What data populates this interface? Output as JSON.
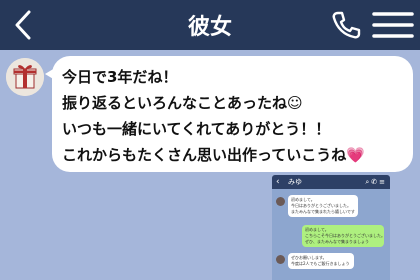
{
  "header": {
    "title": "彼女",
    "back_icon": "chevron-left-icon",
    "call_icon": "phone-icon",
    "menu_icon": "hamburger-menu-icon"
  },
  "colors": {
    "header_bg": "#263859",
    "chat_bg": "#a5b6da",
    "bubble_bg": "#ffffff"
  },
  "message": {
    "avatar_icon": "gift-box-icon",
    "lines": [
      "今日で3年だね！",
      "振り返るといろんなことあったね",
      "いつも一緒にいてくれてありがとう！！",
      "これからもたくさん思い出作っていこうね"
    ],
    "emoji_1": "☺",
    "emoji_2": "💗"
  },
  "embedded_screenshot": {
    "contact_name": "みゆ",
    "messages": [
      {
        "line1": "初めまして。",
        "line2": "今日はありがとうございました。",
        "line3": "またみんなで集まれたら嬉しいです"
      },
      {
        "line1": "初めまして。",
        "line2": "こちらこそ今日はありがとうございました。",
        "line3": "ぜひ、またみんなで集まりましょう"
      },
      {
        "line1": "ぜひお願いします。",
        "line2": "今度は2人でもご飯行きましょう"
      }
    ]
  }
}
